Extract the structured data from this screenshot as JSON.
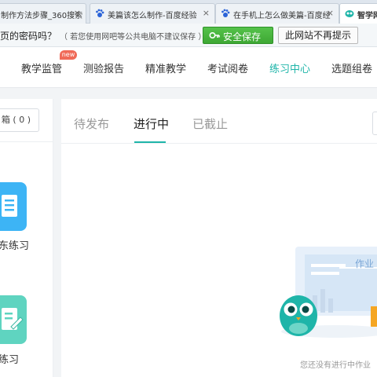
{
  "browser": {
    "tabs": [
      {
        "title": "制作方法步骤_360搜索",
        "close": "×",
        "icon": "tab-icon",
        "active": false
      },
      {
        "title": "美篇该怎么制作-百度经验",
        "close": "×",
        "icon": "paw-icon",
        "active": false
      },
      {
        "title": "在手机上怎么做美篇-百度经",
        "close": "×",
        "icon": "paw-icon",
        "active": false
      },
      {
        "title": "智学网",
        "close": "",
        "icon": "owl-icon",
        "active": true
      }
    ]
  },
  "password_bar": {
    "question": "页的密码吗？",
    "note": "（ 若您使用网吧等公共电脑不建议保存 ）",
    "save_label": "安全保存",
    "never_label": "此网站不再提示"
  },
  "nav": {
    "items": [
      {
        "label": "教学监管",
        "active": false
      },
      {
        "label": "测验报告",
        "active": false
      },
      {
        "label": "精准教学",
        "active": false
      },
      {
        "label": "考试阅卷",
        "active": false
      },
      {
        "label": "练习中心",
        "active": true
      },
      {
        "label": "选题组卷",
        "active": false
      }
    ],
    "new_badge": "new"
  },
  "left_panel": {
    "box_label": "箱 ( 0 )",
    "card1_label": "东练习",
    "card2_label": "练习"
  },
  "main": {
    "subtabs": [
      {
        "label": "待发布",
        "active": false
      },
      {
        "label": "进行中",
        "active": true
      },
      {
        "label": "已截止",
        "active": false
      }
    ],
    "illustration_text": "作业",
    "empty_text": "您还没有进行中作业"
  },
  "colors": {
    "accent": "#1fb5a9",
    "save_green": "#3ea834",
    "card_blue": "#3db4f5",
    "card_teal": "#5fd4c0",
    "badge_red": "#f06a58"
  }
}
